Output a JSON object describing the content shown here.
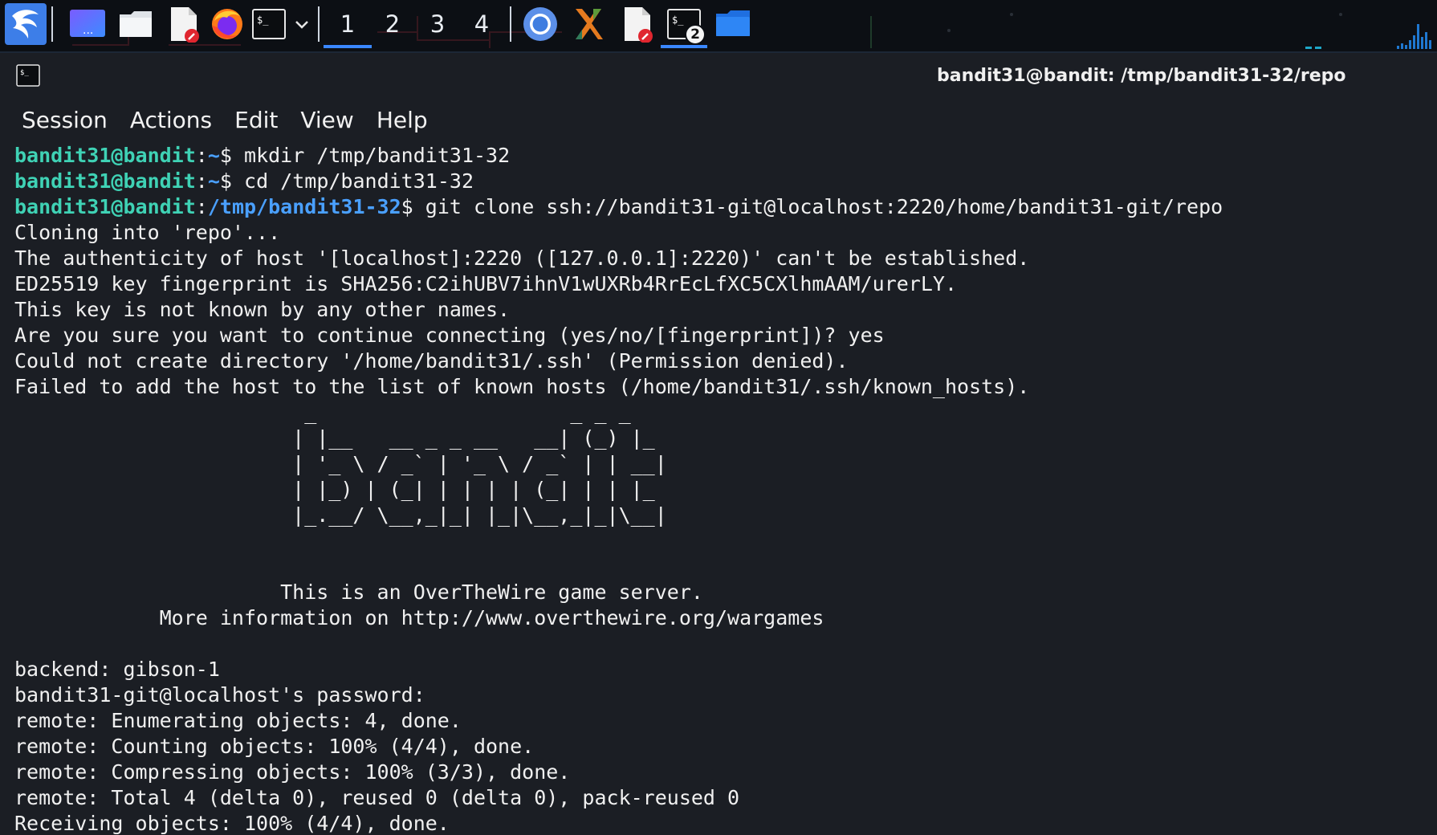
{
  "taskbar": {
    "workspaces": [
      "1",
      "2",
      "3",
      "4"
    ],
    "active_workspace": "1",
    "terminal_task_badge": "2",
    "accent": "#3a87ff"
  },
  "window": {
    "title": "bandit31@bandit: /tmp/bandit31-32/repo"
  },
  "menu": [
    "Session",
    "Actions",
    "Edit",
    "View",
    "Help"
  ],
  "terminal": {
    "colors": {
      "user": "#3fd2b5",
      "path": "#4aa0ff",
      "text": "#f0f0f0"
    },
    "prompts": [
      {
        "user": "bandit31@bandit",
        "path": "~",
        "command": " mkdir /tmp/bandit31-32"
      },
      {
        "user": "bandit31@bandit",
        "path": "~",
        "command": " cd /tmp/bandit31-32"
      },
      {
        "user": "bandit31@bandit",
        "path": "/tmp/bandit31-32",
        "command": " git clone ssh://bandit31-git@localhost:2220/home/bandit31-git/repo"
      }
    ],
    "output": [
      "Cloning into 'repo'...",
      "The authenticity of host '[localhost]:2220 ([127.0.0.1]:2220)' can't be established.",
      "ED25519 key fingerprint is SHA256:C2ihUBV7ihnV1wUXRb4RrEcLfXC5CXlhmAAM/urerLY.",
      "This key is not known by any other names.",
      "Are you sure you want to continue connecting (yes/no/[fingerprint])? yes",
      "Could not create directory '/home/bandit31/.ssh' (Permission denied).",
      "Failed to add the host to the list of known hosts (/home/bandit31/.ssh/known_hosts).",
      "                        _                     _ _ _   ",
      "                       | |__   __ _ _ __   __| (_) |_ ",
      "                       | '_ \\ / _` | '_ \\ / _` | | __|",
      "                       | |_) | (_| | | | | (_| | | |_ ",
      "                       |_.__/ \\__,_|_| |_|\\__,_|_|\\__|",
      "",
      "",
      "                      This is an OverTheWire game server.",
      "            More information on http://www.overthewire.org/wargames",
      "",
      "backend: gibson-1",
      "bandit31-git@localhost's password:",
      "remote: Enumerating objects: 4, done.",
      "remote: Counting objects: 100% (4/4), done.",
      "remote: Compressing objects: 100% (3/3), done.",
      "remote: Total 4 (delta 0), reused 0 (delta 0), pack-reused 0",
      "Receiving objects: 100% (4/4), done."
    ]
  }
}
